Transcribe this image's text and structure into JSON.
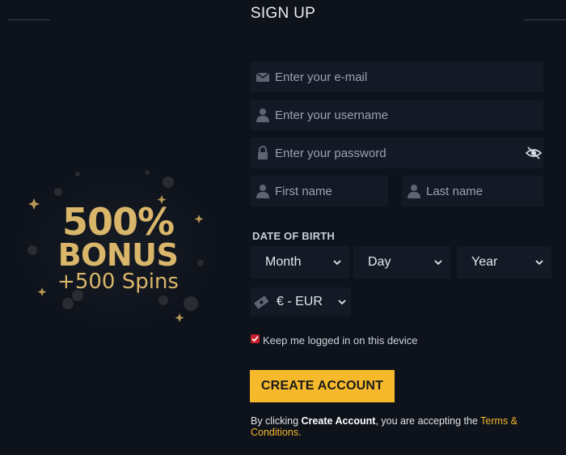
{
  "header": {
    "title": "SIGN UP"
  },
  "promo": {
    "line1": "500%",
    "line2": "BONUS",
    "line3": "+500 Spins"
  },
  "form": {
    "email": {
      "placeholder": "Enter your e-mail",
      "icon": "envelope-icon"
    },
    "username": {
      "placeholder": "Enter your username",
      "icon": "user-icon"
    },
    "password": {
      "placeholder": "Enter your password",
      "icon": "lock-icon",
      "toggle_icon": "eye-slash-icon"
    },
    "first_name": {
      "placeholder": "First name",
      "icon": "user-icon"
    },
    "last_name": {
      "placeholder": "Last name",
      "icon": "user-icon"
    },
    "dob_label": "DATE OF BIRTH",
    "dob": {
      "month": "Month",
      "day": "Day",
      "year": "Year"
    },
    "currency": {
      "value": "€ - EUR",
      "icon": "money-icon"
    },
    "keep_logged": {
      "label": "Keep me logged in on this device",
      "checked": true
    },
    "create_button": "CREATE ACCOUNT",
    "terms": {
      "prefix": "By clicking ",
      "bold": "Create Account",
      "middle": ", you are accepting the ",
      "link": "Terms & Conditions."
    }
  },
  "colors": {
    "background": "#0e121b",
    "field": "#141926",
    "accent": "#f6b92c",
    "gold_text": "#d9b66a",
    "checkbox": "#c8202b"
  }
}
